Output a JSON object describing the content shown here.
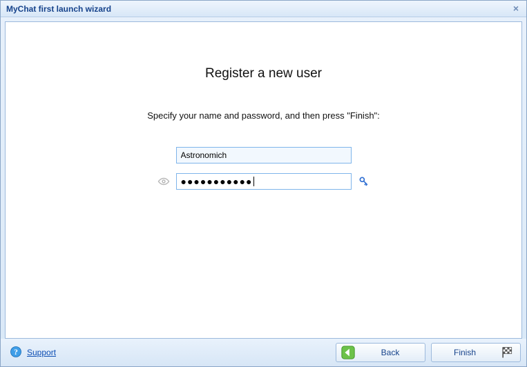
{
  "window": {
    "title": "MyChat first launch wizard",
    "close_symbol": "×"
  },
  "main": {
    "heading": "Register a new user",
    "instruction": "Specify your name and password, and then press \"Finish\":",
    "username_value": "Astronomich",
    "password_mask": "●●●●●●●●●●●"
  },
  "footer": {
    "support_label": "Support",
    "back_label": "Back",
    "finish_label": "Finish"
  }
}
